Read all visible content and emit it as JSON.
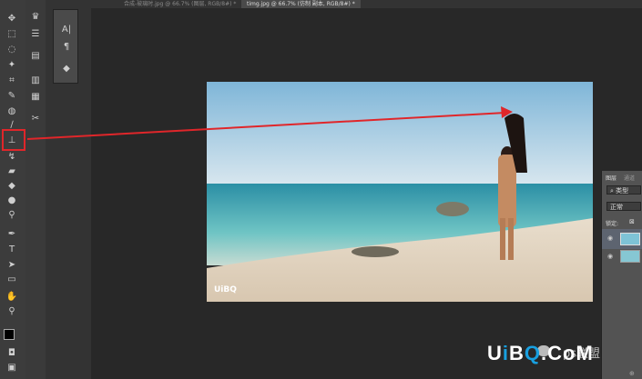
{
  "tabs": [
    {
      "label": "合成-玻璃时.jpg @ 66.7% (图层, RGB/8#) *",
      "active": false
    },
    {
      "label": "timg.jpg @ 66.7% (仿制 副本, RGB/8#) *",
      "active": true
    }
  ],
  "mini_panel": {
    "icons": [
      "text-icon",
      "pilcrow-icon",
      "cube-icon"
    ]
  },
  "layers_panel": {
    "tabs": [
      "图层",
      "通道"
    ],
    "filter_label": "类型",
    "blend_mode": "正常",
    "lock_label": "锁定:"
  },
  "photo": {
    "watermark": "UiBQ"
  },
  "watermark": {
    "brand_prefix": "U",
    "brand_i": "i",
    "brand_b": "B",
    "brand_q": "Q",
    "brand_suffix": ".CoM",
    "account": "ps联盟"
  },
  "colors": {
    "highlight": "#e0262a",
    "accent": "#18a0e0"
  }
}
